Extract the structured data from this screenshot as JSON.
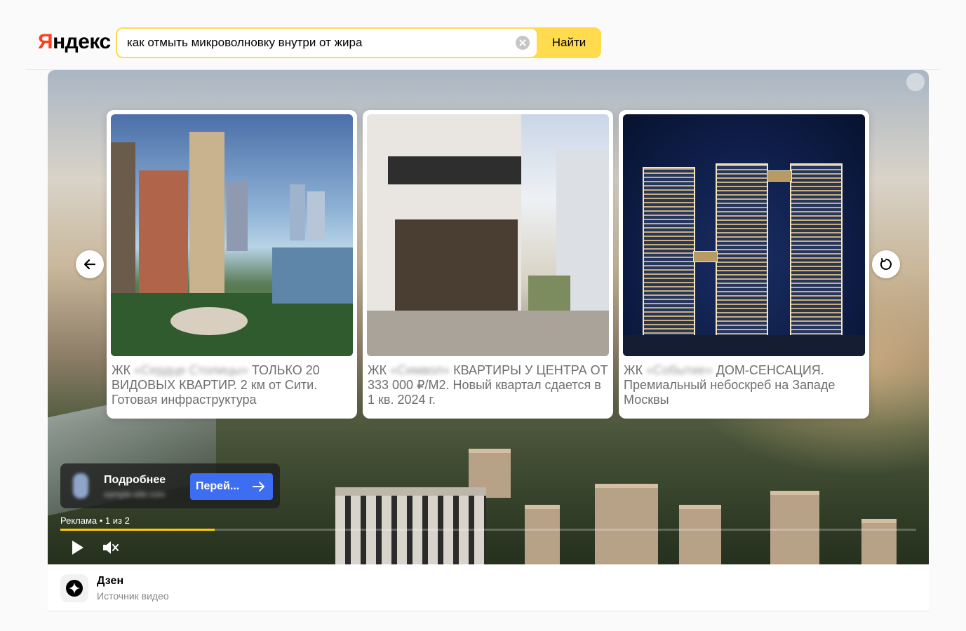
{
  "header": {
    "logo": "Яндекс",
    "search_query": "как отмыть микроволновку внутри от жира",
    "search_button": "Найти"
  },
  "cards": [
    {
      "prefix": "ЖК",
      "name_blurred": "«Сердце Столицы»",
      "text": "ТОЛЬКО 20 ВИДОВЫХ КВАРТИР. 2 км от Сити. Готовая инфраструктура"
    },
    {
      "prefix": "ЖК",
      "name_blurred": "«Символ»",
      "text": "КВАРТИРЫ У ЦЕНТРА ОТ 333 000 ₽/М2. Новый квартал сдается в 1 кв. 2024 г."
    },
    {
      "prefix": "ЖК",
      "name_blurred": "«Событие»",
      "text": "ДОМ-СЕНСАЦИЯ. Премиальный небоскреб на Западе Москвы"
    }
  ],
  "ad": {
    "title": "Подробнее",
    "subtitle_blurred": "sample-site.com",
    "cta": "Перей...",
    "label": "Реклама • 1 из 2",
    "progress": 0.18
  },
  "source": {
    "name": "Дзен",
    "subtitle": "Источник видео"
  },
  "colors": {
    "brand_yellow": "#ffdb4d",
    "brand_red": "#fc3f1d",
    "cta_blue": "#3d6df0",
    "progress_yellow": "#ffcc00"
  }
}
